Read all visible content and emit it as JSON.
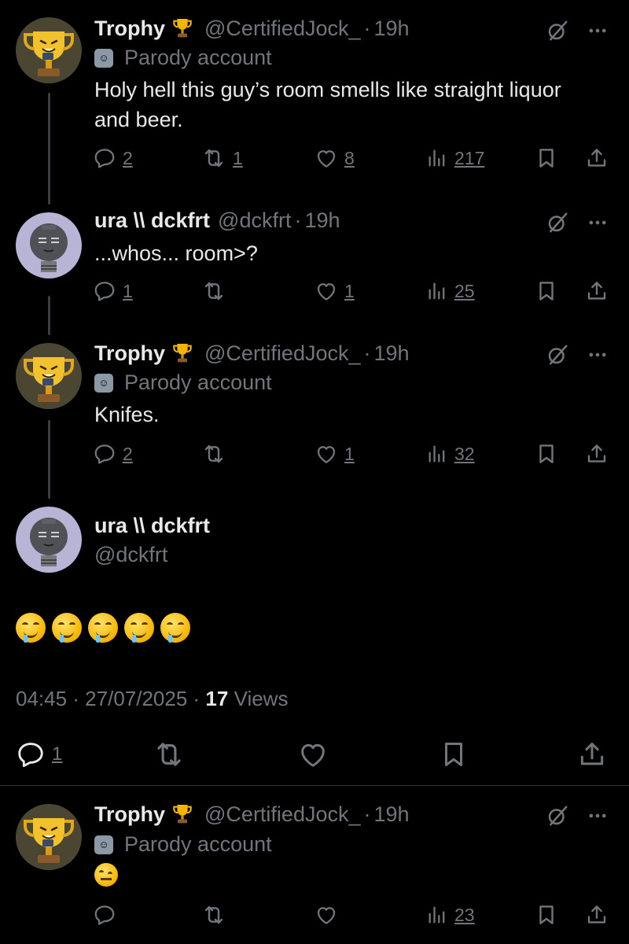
{
  "posts": [
    {
      "name": "Trophy",
      "handle": "@CertifiedJock_",
      "time": "19h",
      "parody_label": "Parody account",
      "text_lines": [
        "Holy hell this guy’s room smells like straight liquor",
        "and beer."
      ],
      "replies": "2",
      "reposts": "1",
      "likes": "8",
      "views": "217"
    },
    {
      "name": "ura \\\\ dckfrt",
      "handle": "@dckfrt",
      "time": "19h",
      "text": "...whos... room>?",
      "replies": "1",
      "reposts": "",
      "likes": "1",
      "views": "25"
    },
    {
      "name": "Trophy",
      "handle": "@CertifiedJock_",
      "time": "19h",
      "parody_label": "Parody account",
      "text": "Knifes.",
      "replies": "2",
      "reposts": "",
      "likes": "1",
      "views": "32"
    }
  ],
  "main_post": {
    "name": "ura \\\\ dckfrt",
    "handle": "@dckfrt",
    "emoji_count": 5,
    "timestamp": "04:45 · 27/07/2025 ·",
    "views_count": "17",
    "views_label": "Views",
    "replies": "1"
  },
  "reply_post": {
    "name": "Trophy",
    "handle": "@CertifiedJock_",
    "time": "19h",
    "parody_label": "Parody account",
    "views": "23"
  },
  "separator": "·",
  "icons": {
    "badge": "trophy-icon",
    "mute": "grok-slash-icon",
    "more": "more-dots-icon",
    "reply": "reply-icon",
    "repost": "repost-icon",
    "like": "heart-icon",
    "views": "views-bars-icon",
    "bookmark": "bookmark-icon",
    "share": "share-icon"
  },
  "colors": {
    "background": "#000000",
    "text": "#e7e9ea",
    "secondary": "#71767b",
    "divider": "#2f3336"
  }
}
